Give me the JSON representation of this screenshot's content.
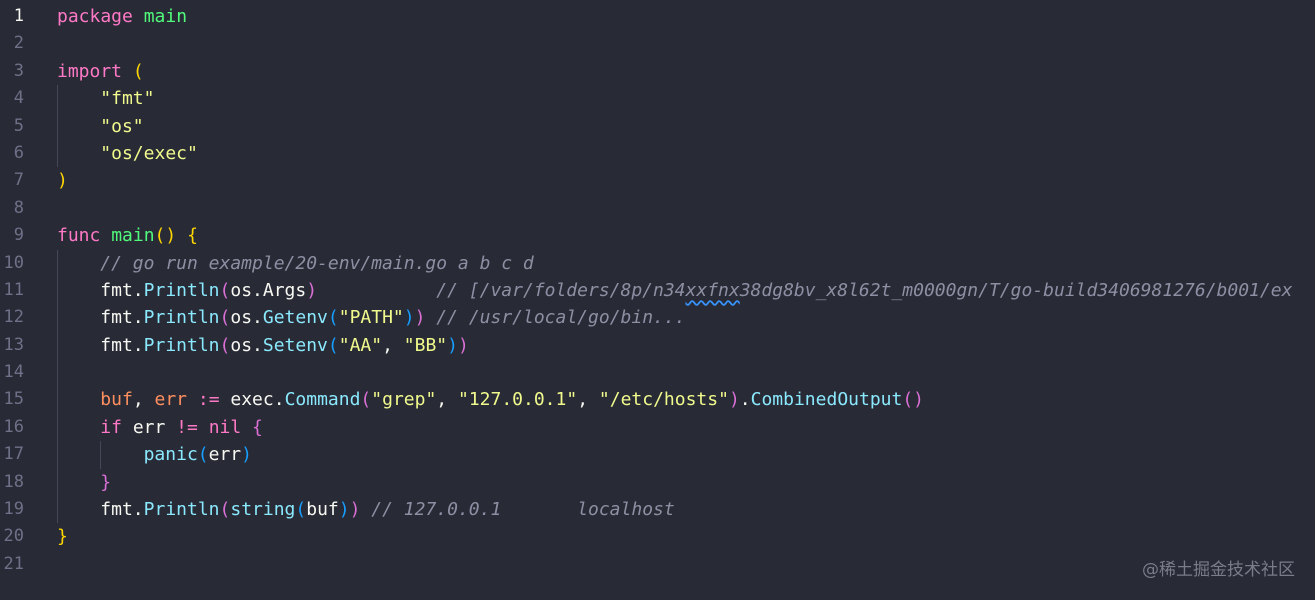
{
  "editor": {
    "lines": [
      {
        "n": "1",
        "active": true,
        "indent": 0,
        "tokens": [
          {
            "t": "package ",
            "c": "kw"
          },
          {
            "t": "main",
            "c": "fn"
          }
        ]
      },
      {
        "n": "2",
        "indent": 0,
        "tokens": []
      },
      {
        "n": "3",
        "indent": 0,
        "tokens": [
          {
            "t": "import ",
            "c": "kw"
          },
          {
            "t": "(",
            "c": "p1"
          }
        ]
      },
      {
        "n": "4",
        "indent": 1,
        "tokens": [
          {
            "t": "\"fmt\"",
            "c": "str"
          }
        ]
      },
      {
        "n": "5",
        "indent": 1,
        "tokens": [
          {
            "t": "\"os\"",
            "c": "str"
          }
        ]
      },
      {
        "n": "6",
        "indent": 1,
        "tokens": [
          {
            "t": "\"os/exec\"",
            "c": "str"
          }
        ]
      },
      {
        "n": "7",
        "indent": 0,
        "tokens": [
          {
            "t": ")",
            "c": "p1"
          }
        ]
      },
      {
        "n": "8",
        "indent": 0,
        "tokens": []
      },
      {
        "n": "9",
        "indent": 0,
        "tokens": [
          {
            "t": "func ",
            "c": "kw"
          },
          {
            "t": "main",
            "c": "fn"
          },
          {
            "t": "()",
            "c": "p1"
          },
          {
            "t": " ",
            "c": "plain"
          },
          {
            "t": "{",
            "c": "p1"
          }
        ]
      },
      {
        "n": "10",
        "indent": 1,
        "tokens": [
          {
            "t": "// go run example/20-env/main.go a b c d",
            "c": "com"
          }
        ]
      },
      {
        "n": "11",
        "indent": 1,
        "tokens": [
          {
            "t": "fmt.",
            "c": "plain"
          },
          {
            "t": "Println",
            "c": "blue"
          },
          {
            "t": "(",
            "c": "p2"
          },
          {
            "t": "os.Args",
            "c": "plain"
          },
          {
            "t": ")",
            "c": "p2"
          },
          {
            "t": "           // [/var/folders/8p/n34",
            "c": "com"
          },
          {
            "t": "xxfnx",
            "c": "com",
            "squiggle": true
          },
          {
            "t": "38dg8bv_x8l62t_m0000gn/T/go-build3406981276/b001/ex",
            "c": "com"
          }
        ]
      },
      {
        "n": "12",
        "indent": 1,
        "tokens": [
          {
            "t": "fmt.",
            "c": "plain"
          },
          {
            "t": "Println",
            "c": "blue"
          },
          {
            "t": "(",
            "c": "p2"
          },
          {
            "t": "os.",
            "c": "plain"
          },
          {
            "t": "Getenv",
            "c": "blue"
          },
          {
            "t": "(",
            "c": "p3"
          },
          {
            "t": "\"PATH\"",
            "c": "str"
          },
          {
            "t": ")",
            "c": "p3"
          },
          {
            "t": ")",
            "c": "p2"
          },
          {
            "t": " // /usr/local/go/bin...",
            "c": "com"
          }
        ]
      },
      {
        "n": "13",
        "indent": 1,
        "tokens": [
          {
            "t": "fmt.",
            "c": "plain"
          },
          {
            "t": "Println",
            "c": "blue"
          },
          {
            "t": "(",
            "c": "p2"
          },
          {
            "t": "os.",
            "c": "plain"
          },
          {
            "t": "Setenv",
            "c": "blue"
          },
          {
            "t": "(",
            "c": "p3"
          },
          {
            "t": "\"AA\"",
            "c": "str"
          },
          {
            "t": ", ",
            "c": "plain"
          },
          {
            "t": "\"BB\"",
            "c": "str"
          },
          {
            "t": ")",
            "c": "p3"
          },
          {
            "t": ")",
            "c": "p2"
          }
        ]
      },
      {
        "n": "14",
        "indent": 1,
        "tokens": []
      },
      {
        "n": "15",
        "indent": 1,
        "tokens": [
          {
            "t": "buf",
            "c": "var"
          },
          {
            "t": ", ",
            "c": "plain"
          },
          {
            "t": "err",
            "c": "var"
          },
          {
            "t": " := ",
            "c": "kw"
          },
          {
            "t": "exec.",
            "c": "plain"
          },
          {
            "t": "Command",
            "c": "blue"
          },
          {
            "t": "(",
            "c": "p2"
          },
          {
            "t": "\"grep\"",
            "c": "str"
          },
          {
            "t": ", ",
            "c": "plain"
          },
          {
            "t": "\"127.0.0.1\"",
            "c": "str"
          },
          {
            "t": ", ",
            "c": "plain"
          },
          {
            "t": "\"/etc/hosts\"",
            "c": "str"
          },
          {
            "t": ")",
            "c": "p2"
          },
          {
            "t": ".",
            "c": "plain"
          },
          {
            "t": "CombinedOutput",
            "c": "blue"
          },
          {
            "t": "()",
            "c": "p2"
          }
        ]
      },
      {
        "n": "16",
        "indent": 1,
        "tokens": [
          {
            "t": "if ",
            "c": "kw"
          },
          {
            "t": "err",
            "c": "plain"
          },
          {
            "t": " != ",
            "c": "kw"
          },
          {
            "t": "nil",
            "c": "kw"
          },
          {
            "t": " ",
            "c": "plain"
          },
          {
            "t": "{",
            "c": "p2"
          }
        ]
      },
      {
        "n": "17",
        "indent": 2,
        "tokens": [
          {
            "t": "panic",
            "c": "blue"
          },
          {
            "t": "(",
            "c": "p3"
          },
          {
            "t": "err",
            "c": "plain"
          },
          {
            "t": ")",
            "c": "p3"
          }
        ]
      },
      {
        "n": "18",
        "indent": 1,
        "tokens": [
          {
            "t": "}",
            "c": "p2"
          }
        ]
      },
      {
        "n": "19",
        "indent": 1,
        "tokens": [
          {
            "t": "fmt.",
            "c": "plain"
          },
          {
            "t": "Println",
            "c": "blue"
          },
          {
            "t": "(",
            "c": "p2"
          },
          {
            "t": "string",
            "c": "blue"
          },
          {
            "t": "(",
            "c": "p3"
          },
          {
            "t": "buf",
            "c": "plain"
          },
          {
            "t": ")",
            "c": "p3"
          },
          {
            "t": ")",
            "c": "p2"
          },
          {
            "t": " // 127.0.0.1       localhost",
            "c": "com"
          }
        ]
      },
      {
        "n": "20",
        "indent": 0,
        "tokens": [
          {
            "t": "}",
            "c": "p1"
          }
        ]
      },
      {
        "n": "21",
        "indent": 0,
        "tokens": []
      }
    ]
  },
  "watermark": "@稀土掘金技术社区"
}
